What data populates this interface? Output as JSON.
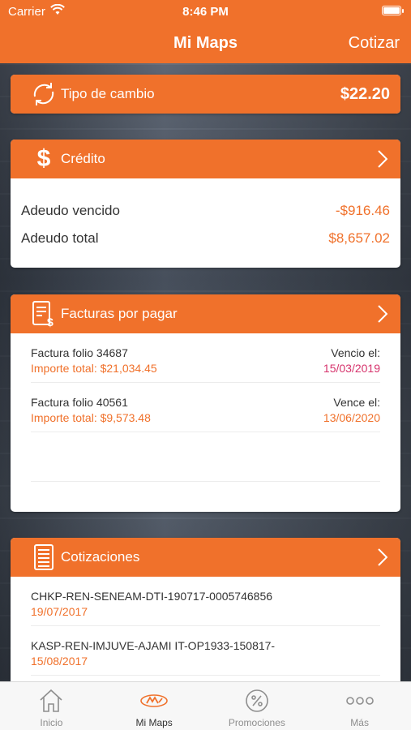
{
  "status": {
    "carrier": "Carrier",
    "time": "8:46 PM"
  },
  "nav": {
    "title": "Mi Maps",
    "action": "Cotizar"
  },
  "exchange": {
    "label": "Tipo de cambio",
    "value": "$22.20"
  },
  "credit": {
    "title": "Crédito",
    "rows": [
      {
        "label": "Adeudo vencido",
        "value": "-$916.46"
      },
      {
        "label": "Adeudo total",
        "value": "$8,657.02"
      }
    ]
  },
  "invoices": {
    "title": "Facturas por pagar",
    "items": [
      {
        "folio": "Factura folio 34687",
        "total": "Importe total: $21,034.45",
        "due_label": "Vencio el:",
        "due_date": "15/03/2019",
        "overdue": true
      },
      {
        "folio": "Factura folio 40561",
        "total": "Importe total: $9,573.48",
        "due_label": "Vence el:",
        "due_date": "13/06/2020",
        "overdue": false
      }
    ]
  },
  "quotes": {
    "title": "Cotizaciones",
    "items": [
      {
        "code": "CHKP-REN-SENEAM-DTI-190717-0005746856",
        "date": "19/07/2017"
      },
      {
        "code": "KASP-REN-IMJUVE-AJAMI IT-OP1933-150817-",
        "date": "15/08/2017"
      }
    ]
  },
  "tabs": [
    {
      "label": "Inicio",
      "icon": "home-icon",
      "active": false
    },
    {
      "label": "Mi Maps",
      "icon": "maps-logo-icon",
      "active": true
    },
    {
      "label": "Promociones",
      "icon": "percent-icon",
      "active": false
    },
    {
      "label": "Más",
      "icon": "more-icon",
      "active": false
    }
  ],
  "colors": {
    "accent": "#f0712b",
    "overdue": "#d6336c",
    "text": "#333333"
  }
}
